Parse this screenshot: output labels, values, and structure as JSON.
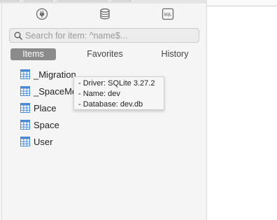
{
  "mode_buttons": [
    {
      "icon": "plug-icon"
    },
    {
      "icon": "database-icon"
    },
    {
      "icon": "sql-icon",
      "label": "SQL"
    }
  ],
  "search": {
    "placeholder": "Search for item: ^name$..."
  },
  "tabs": [
    {
      "label": "Items",
      "active": true
    },
    {
      "label": "Favorites",
      "active": false
    },
    {
      "label": "History",
      "active": false
    }
  ],
  "items": [
    {
      "label": "_Migration",
      "icon": "table-icon"
    },
    {
      "label": "_SpaceMe",
      "icon": "table-icon"
    },
    {
      "label": "Place",
      "icon": "table-icon"
    },
    {
      "label": "Space",
      "icon": "table-icon"
    },
    {
      "label": "User",
      "icon": "table-icon"
    }
  ],
  "tooltip": {
    "lines": [
      "- Driver: SQLite 3.27.2",
      "- Name: dev",
      "- Database: dev.db"
    ]
  },
  "colors": {
    "active_tab": "#8b8b8b",
    "table_icon": "#4a8ad4",
    "sidebar_bg": "#f5f5f5"
  }
}
